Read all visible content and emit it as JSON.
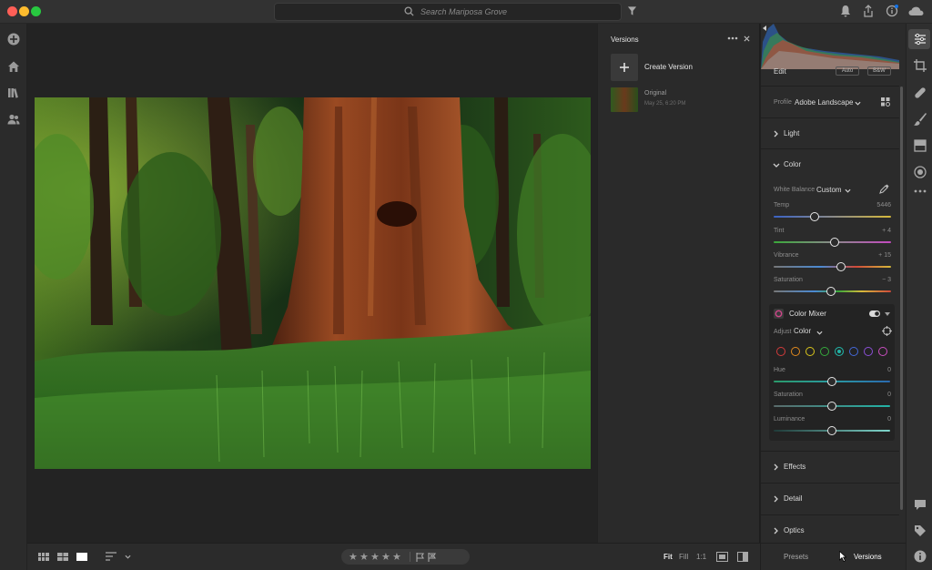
{
  "titlebar": {
    "search_placeholder": "Search Mariposa Grove"
  },
  "versions_panel": {
    "title": "Versions",
    "create_label": "Create Version",
    "items": [
      {
        "name": "Original",
        "date": "May 25, 6:20 PM"
      }
    ]
  },
  "edit": {
    "title": "Edit",
    "auto_label": "Auto",
    "bw_label": "B&W",
    "profile_label": "Profile",
    "profile_value": "Adobe Landscape",
    "sections": {
      "light": "Light",
      "color": "Color",
      "effects": "Effects",
      "detail": "Detail",
      "optics": "Optics"
    },
    "white_balance_label": "White Balance",
    "white_balance_value": "Custom",
    "sliders": [
      {
        "label": "Temp",
        "value": "5446",
        "position": 0.35
      },
      {
        "label": "Tint",
        "value": "+ 4",
        "position": 0.52
      },
      {
        "label": "Vibrance",
        "value": "+ 15",
        "position": 0.57
      },
      {
        "label": "Saturation",
        "value": "− 3",
        "position": 0.49
      }
    ],
    "color_mixer": {
      "title": "Color Mixer",
      "adjust_label": "Adjust",
      "adjust_value": "Color",
      "swatches": [
        "#d23b3b",
        "#e0891e",
        "#d9c51c",
        "#35a93c",
        "#22b3a6",
        "#4468d9",
        "#8a4fd6",
        "#c84dbf"
      ],
      "selected_swatch": 4,
      "sliders": [
        {
          "label": "Hue",
          "value": "0",
          "position": 0.5
        },
        {
          "label": "Saturation",
          "value": "0",
          "position": 0.5
        },
        {
          "label": "Luminance",
          "value": "0",
          "position": 0.5
        }
      ]
    }
  },
  "bottom": {
    "fit": "Fit",
    "fill": "Fill",
    "one_to_one": "1:1",
    "presets": "Presets",
    "versions": "Versions",
    "stars": [
      "★",
      "★",
      "★",
      "★",
      "★"
    ]
  },
  "colors": {
    "accent": "#1473e6",
    "panel_bg": "#2b2b2b",
    "canvas_bg": "#232323"
  }
}
